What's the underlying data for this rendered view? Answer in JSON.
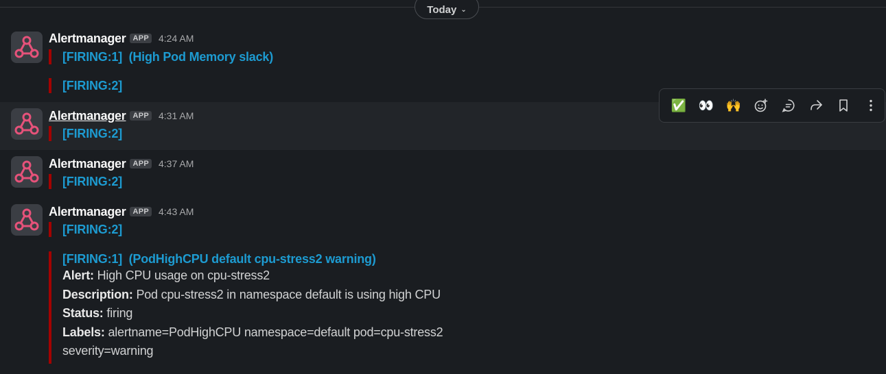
{
  "divider": {
    "label": "Today"
  },
  "messages": [
    {
      "sender": "Alertmanager",
      "badge": "APP",
      "time": "4:24 AM",
      "attachments": [
        {
          "title": "[FIRING:1]  (High Pod Memory slack)"
        },
        {
          "title": "[FIRING:2]"
        }
      ]
    },
    {
      "sender": "Alertmanager",
      "badge": "APP",
      "time": "4:31 AM",
      "attachments": [
        {
          "title": "[FIRING:2]"
        }
      ]
    },
    {
      "sender": "Alertmanager",
      "badge": "APP",
      "time": "4:37 AM",
      "attachments": [
        {
          "title": "[FIRING:2]"
        }
      ]
    },
    {
      "sender": "Alertmanager",
      "badge": "APP",
      "time": "4:43 AM",
      "attachments": [
        {
          "title": "[FIRING:2]"
        },
        {
          "title": "[FIRING:1]  (PodHighCPU default cpu-stress2 warning)",
          "fields": [
            {
              "label": "Alert:",
              "value": "High CPU usage on cpu-stress2"
            },
            {
              "label": "Description:",
              "value": "Pod cpu-stress2 in namespace default is using high CPU"
            },
            {
              "label": "Status:",
              "value": "firing"
            },
            {
              "label": "Labels:",
              "value": "alertname=PodHighCPU namespace=default pod=cpu-stress2"
            }
          ],
          "continuation": "severity=warning"
        }
      ]
    }
  ],
  "toolbar": {
    "items": [
      "check-mark-emoji",
      "eyes-emoji",
      "raised-hands-emoji",
      "add-reaction-icon",
      "reply-in-thread-icon",
      "forward-icon",
      "save-bookmark-icon",
      "more-actions-icon"
    ],
    "check_glyph": "✅",
    "eyes_glyph": "👀",
    "hands_glyph": "🙌"
  },
  "colors": {
    "background": "#1a1d21",
    "hover_background": "#222529",
    "link": "#1d9bd1",
    "attachment_bar": "#a30200",
    "avatar_logo": "#e6527a"
  }
}
